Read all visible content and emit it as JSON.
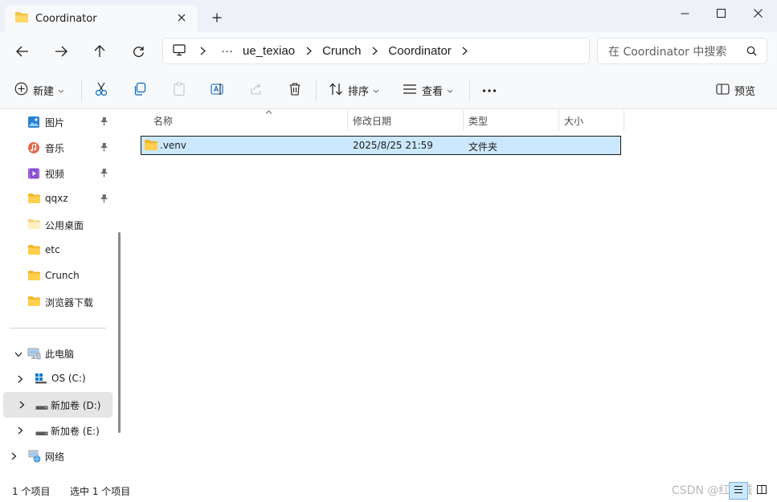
{
  "window": {
    "tab_title": "Coordinator",
    "new_tab_label": "+"
  },
  "address": {
    "ellipsis": "···",
    "crumbs": [
      "ue_texiao",
      "Crunch",
      "Coordinator"
    ]
  },
  "search": {
    "placeholder": "在 Coordinator 中搜索"
  },
  "toolbar": {
    "new_label": "新建",
    "sort_label": "排序",
    "view_label": "查看",
    "more_label": "···",
    "preview_label": "预览"
  },
  "sidebar": {
    "quick_access": [
      {
        "label": "图片",
        "icon": "pictures-icon",
        "pinned": true
      },
      {
        "label": "音乐",
        "icon": "music-icon",
        "pinned": true
      },
      {
        "label": "视频",
        "icon": "videos-icon",
        "pinned": true
      },
      {
        "label": "qqxz",
        "icon": "folder-icon",
        "pinned": true
      },
      {
        "label": "公用桌面",
        "icon": "folder-icon",
        "pinned": false
      },
      {
        "label": "etc",
        "icon": "folder-icon",
        "pinned": false
      },
      {
        "label": "Crunch",
        "icon": "folder-icon",
        "pinned": false
      },
      {
        "label": "浏览器下载",
        "icon": "folder-icon",
        "pinned": false
      }
    ],
    "this_pc": "此电脑",
    "drives": [
      {
        "label": "OS (C:)",
        "icon": "windows-drive-icon",
        "selected": false
      },
      {
        "label": "新加卷 (D:)",
        "icon": "drive-icon",
        "selected": true
      },
      {
        "label": "新加卷 (E:)",
        "icon": "drive-icon",
        "selected": false
      }
    ],
    "network": "网络"
  },
  "columns": {
    "name": "名称",
    "modified": "修改日期",
    "type": "类型",
    "size": "大小"
  },
  "files": [
    {
      "name": ".venv",
      "modified": "2025/8/25 21:59",
      "type": "文件夹",
      "size": ""
    }
  ],
  "status": {
    "count": "1 个项目",
    "selected": "选中 1 个项目"
  },
  "watermark": "CSDN @红叶城",
  "colors": {
    "accent": "#0067c0",
    "selection": "#cce8ff",
    "folder": "#f5c342"
  }
}
